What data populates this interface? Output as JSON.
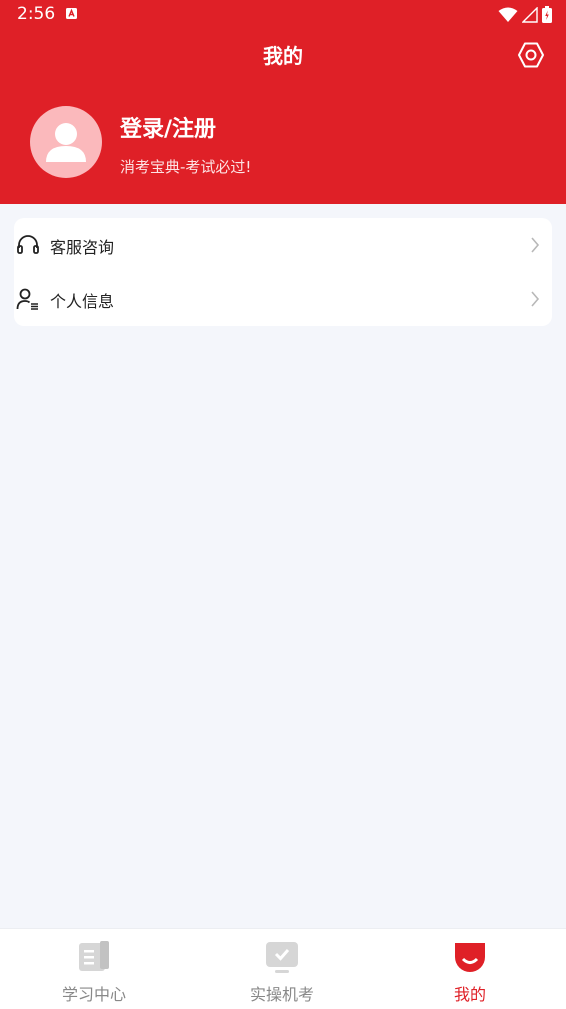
{
  "status_bar": {
    "time": "2:56"
  },
  "header": {
    "title": "我的",
    "login_label": "登录/注册",
    "slogan": "消考宝典-考试必过!"
  },
  "menu": {
    "items": [
      {
        "label": "客服咨询",
        "icon": "headset-icon"
      },
      {
        "label": "个人信息",
        "icon": "user-info-icon"
      }
    ]
  },
  "tabbar": {
    "tabs": [
      {
        "label": "学习中心",
        "icon": "book-icon",
        "active": false
      },
      {
        "label": "实操机考",
        "icon": "monitor-check-icon",
        "active": false
      },
      {
        "label": "我的",
        "icon": "profile-icon",
        "active": true
      }
    ]
  },
  "colors": {
    "primary": "#df2027",
    "background": "#f4f6fb",
    "inactive": "#888888",
    "avatar_bg": "#fbb9bc"
  }
}
